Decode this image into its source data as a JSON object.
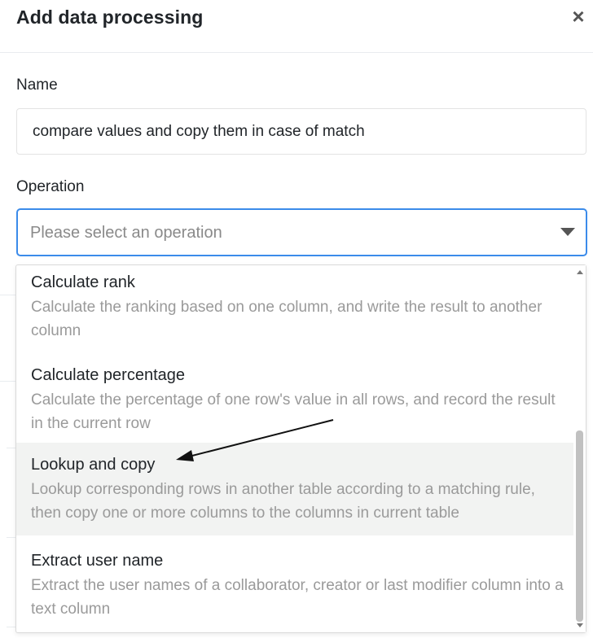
{
  "dialog": {
    "title": "Add data processing",
    "close_symbol": "×"
  },
  "form": {
    "name_label": "Name",
    "name_value": "compare values and copy them in case of match",
    "operation_label": "Operation",
    "operation_placeholder": "Please select an operation"
  },
  "dropdown": {
    "items": [
      {
        "title": "Calculate rank",
        "description": "Calculate the ranking based on one column, and write the result to another column"
      },
      {
        "title": "Calculate percentage",
        "description": "Calculate the percentage of one row's value in all rows, and record the result in the current row"
      },
      {
        "title": "Lookup and copy",
        "description": "Lookup corresponding rows in another table according to a matching rule, then copy one or more columns to the columns in current table",
        "highlighted": true
      },
      {
        "title": "Extract user name",
        "description": "Extract the user names of a collaborator, creator or last modifier column into a text column"
      }
    ]
  },
  "colors": {
    "select_border": "#3b8bea",
    "highlight_bg": "#f2f3f2",
    "accent_orange": "#ff8000"
  },
  "icons": [
    "close-icon",
    "chevron-down-icon",
    "scroll-up-icon",
    "scroll-down-icon",
    "annotation-arrow"
  ]
}
